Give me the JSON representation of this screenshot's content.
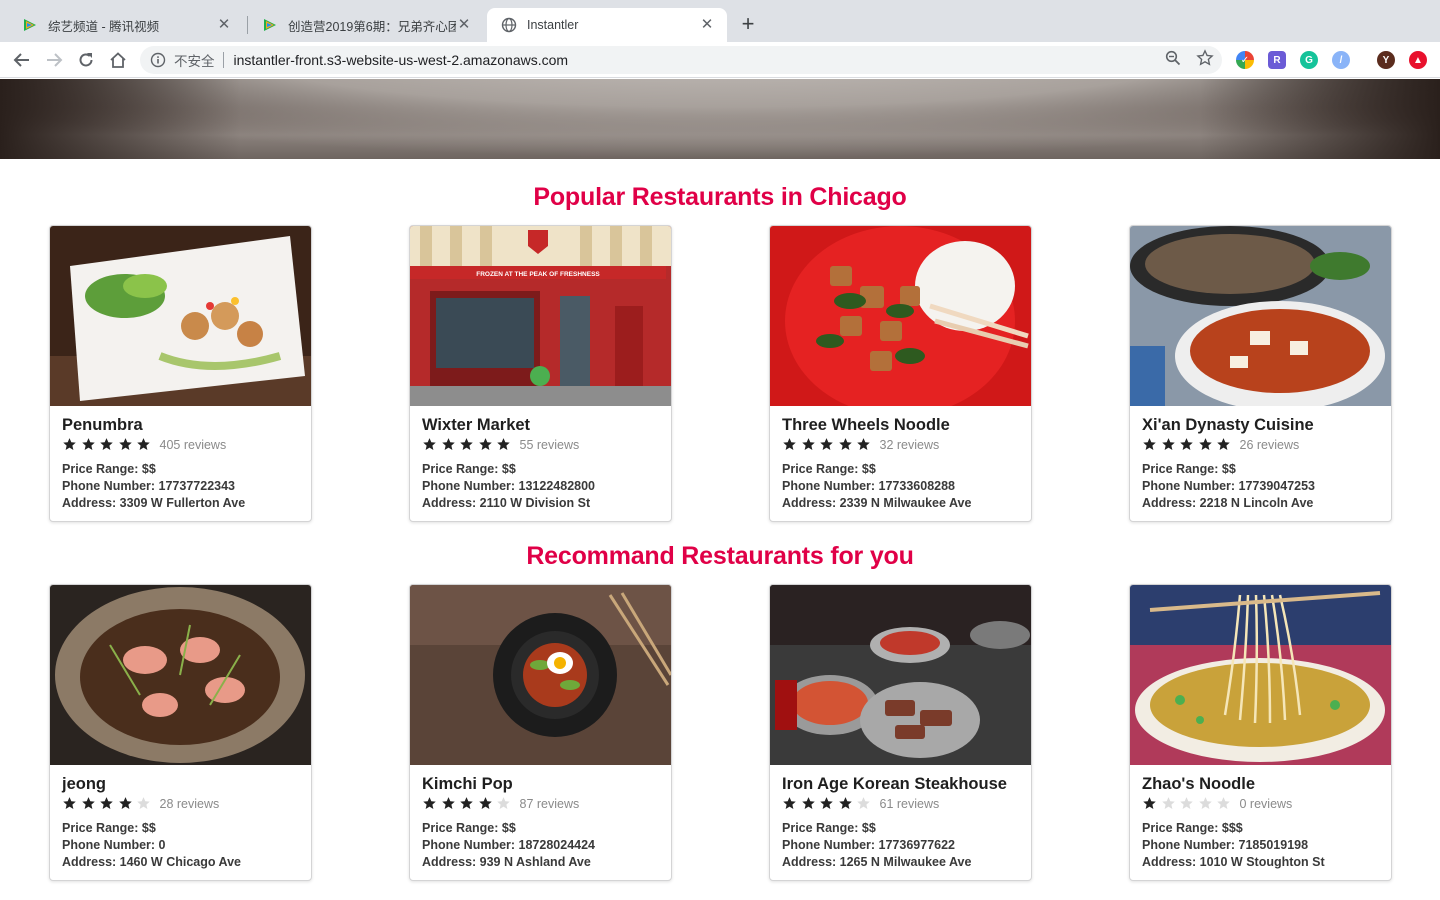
{
  "browser": {
    "tabs": [
      {
        "title": "综艺频道 - 腾讯视频",
        "icon": "tencent-video-icon"
      },
      {
        "title": "创造营2019第6期：兄弟齐心团",
        "icon": "tencent-video-icon"
      },
      {
        "title": "Instantler",
        "icon": "globe-icon"
      }
    ],
    "insecure_label": "不安全",
    "url": "instantler-front.s3-website-us-west-2.amazonaws.com",
    "profile_initial": "Y"
  },
  "sections": {
    "popular_title": "Popular Restaurants in Chicago",
    "recommend_title": "Recommand Restaurants for you"
  },
  "popular": [
    {
      "name": "Penumbra",
      "rating": 5,
      "reviews": "405 reviews",
      "price": "Price Range: $$",
      "phone": "Phone Number: 17737722343",
      "address": "Address: 3309 W Fullerton Ave"
    },
    {
      "name": "Wixter Market",
      "rating": 5,
      "reviews": "55 reviews",
      "price": "Price Range: $$",
      "phone": "Phone Number: 13122482800",
      "address": "Address: 2110 W Division St",
      "sign": "FROZEN AT THE PEAK OF FRESHNESS"
    },
    {
      "name": "Three Wheels Noodle",
      "rating": 5,
      "reviews": "32 reviews",
      "price": "Price Range: $$",
      "phone": "Phone Number: 17733608288",
      "address": "Address: 2339 N Milwaukee Ave"
    },
    {
      "name": "Xi'an Dynasty Cuisine",
      "rating": 5,
      "reviews": "26 reviews",
      "price": "Price Range: $$",
      "phone": "Phone Number: 17739047253",
      "address": "Address: 2218 N Lincoln Ave"
    }
  ],
  "recommend": [
    {
      "name": "jeong",
      "rating": 4,
      "reviews": "28 reviews",
      "price": "Price Range: $$",
      "phone": "Phone Number: 0",
      "address": "Address: 1460 W Chicago Ave"
    },
    {
      "name": "Kimchi Pop",
      "rating": 4,
      "reviews": "87 reviews",
      "price": "Price Range: $$",
      "phone": "Phone Number: 18728024424",
      "address": "Address: 939 N Ashland Ave"
    },
    {
      "name": "Iron Age Korean Steakhouse",
      "rating": 4,
      "reviews": "61 reviews",
      "price": "Price Range: $$",
      "phone": "Phone Number: 17736977622",
      "address": "Address: 1265 N Milwaukee Ave"
    },
    {
      "name": "Zhao's Noodle",
      "rating": 1,
      "reviews": "0 reviews",
      "price": "Price Range: $$$",
      "phone": "Phone Number: 7185019198",
      "address": "Address: 1010 W Stoughton St"
    }
  ],
  "colors": {
    "accent": "#e00047",
    "star_on": "#222222",
    "star_off": "#dcdcdc"
  }
}
